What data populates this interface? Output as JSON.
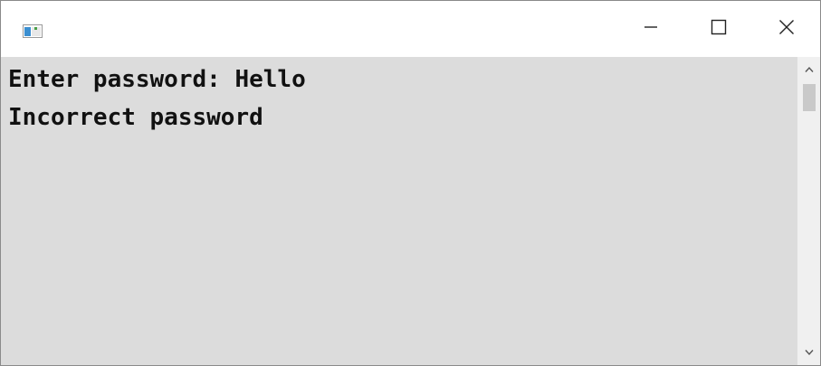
{
  "window": {
    "app_icon": "console-app-icon",
    "controls": {
      "minimize_icon": "minimize-icon",
      "maximize_icon": "maximize-icon",
      "close_icon": "close-icon"
    }
  },
  "console": {
    "lines": [
      "Enter password: Hello",
      "Incorrect password"
    ],
    "background": "#dcdcdc",
    "text_color": "#111111"
  },
  "scrollbar": {
    "up_icon": "chevron-up-icon",
    "down_icon": "chevron-down-icon",
    "position": 0
  }
}
